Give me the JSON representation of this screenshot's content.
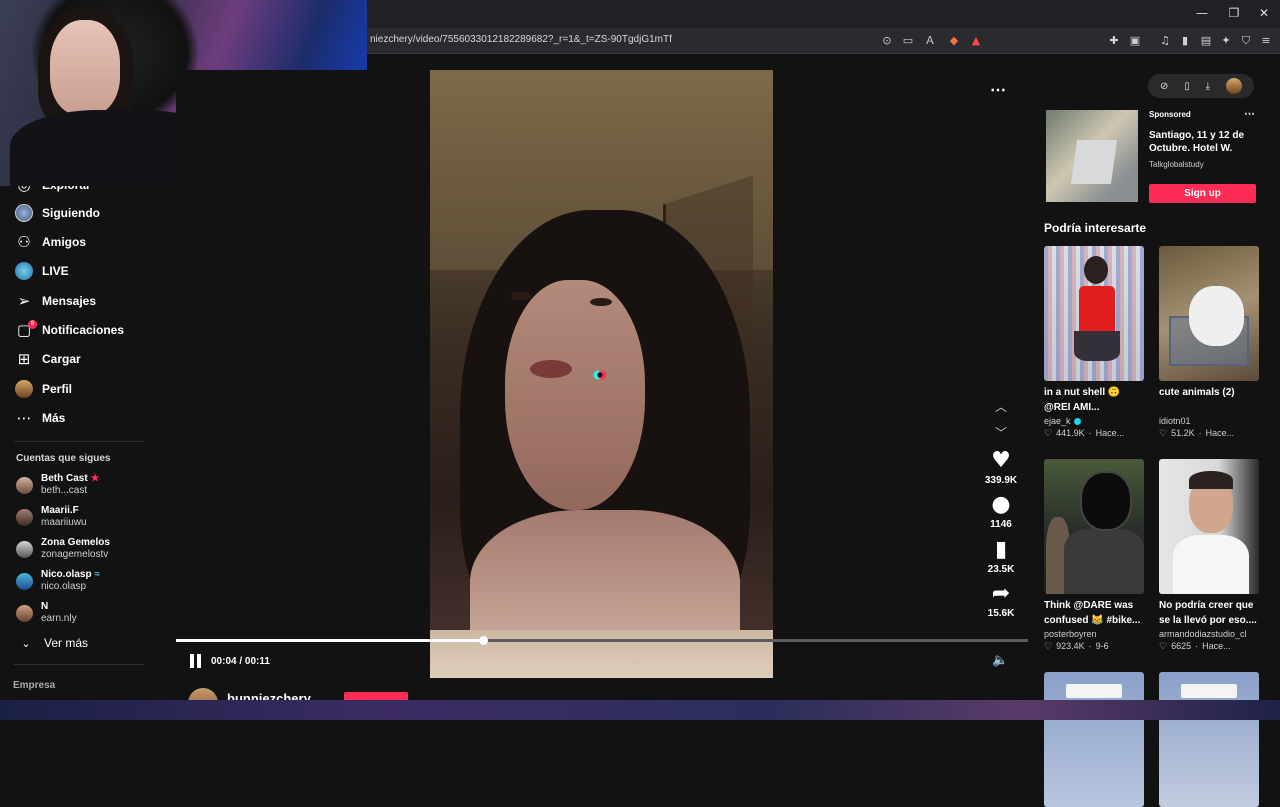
{
  "browser": {
    "url": "niezchery/video/7556033012182289682?_r=1&_t=ZS-90TgdjG1mTf",
    "window_controls": [
      "—",
      "❐",
      "✕"
    ]
  },
  "sidebar": {
    "items": [
      {
        "label": "Explorar",
        "icon": "compass-icon"
      },
      {
        "label": "Siguiendo",
        "icon": "following-avatar"
      },
      {
        "label": "Amigos",
        "icon": "friends-icon"
      },
      {
        "label": "LIVE",
        "icon": "live-icon"
      },
      {
        "label": "Mensajes",
        "icon": "send-icon"
      },
      {
        "label": "Notificaciones",
        "icon": "inbox-icon",
        "badge": "8"
      },
      {
        "label": "Cargar",
        "icon": "upload-icon"
      },
      {
        "label": "Perfil",
        "icon": "profile-avatar"
      },
      {
        "label": "Más",
        "icon": "more-icon"
      }
    ],
    "following_title": "Cuentas que sigues",
    "following": [
      {
        "name": "Beth Cast",
        "handle": "beth...cast"
      },
      {
        "name": "Maarii.F",
        "handle": "maariiuwu"
      },
      {
        "name": "Zona Gemelos",
        "handle": "zonagemelostv"
      },
      {
        "name": "Nico.olasp",
        "handle": "nico.olasp"
      },
      {
        "name": "N",
        "handle": "earn.nly"
      }
    ],
    "see_more": "Ver más",
    "company": "Empresa"
  },
  "player": {
    "likes": "339.9K",
    "comments": "1146",
    "saves": "23.5K",
    "shares": "15.6K",
    "time": "00:04 / 00:11",
    "progress": 0.36,
    "author": "bunniezchery"
  },
  "ad": {
    "sponsored": "Sponsored",
    "title": "Santiago, 11 y 12 de Octubre. Hotel W.",
    "advertiser": "Talkglobalstudy",
    "cta": "Sign up"
  },
  "suggestions": {
    "title": "Podría interesarte",
    "cards": [
      {
        "title": "in a nut shell 🙃 @REI AMI...",
        "author": "ejae_k",
        "verified": true,
        "likes": "441.9K",
        "date": "Hace..."
      },
      {
        "title": "cute animals (2)",
        "author": "idiotn01",
        "verified": false,
        "likes": "51.2K",
        "date": "Hace..."
      },
      {
        "title": "Think @DARE was confused 😹 #bike...",
        "author": "posterboyren",
        "verified": false,
        "likes": "923.4K",
        "date": "9-6"
      },
      {
        "title": "No podría creer que se la llevó por eso....",
        "author": "armandodiazstudio_cl",
        "verified": false,
        "likes": "6625",
        "date": "Hace..."
      }
    ]
  }
}
